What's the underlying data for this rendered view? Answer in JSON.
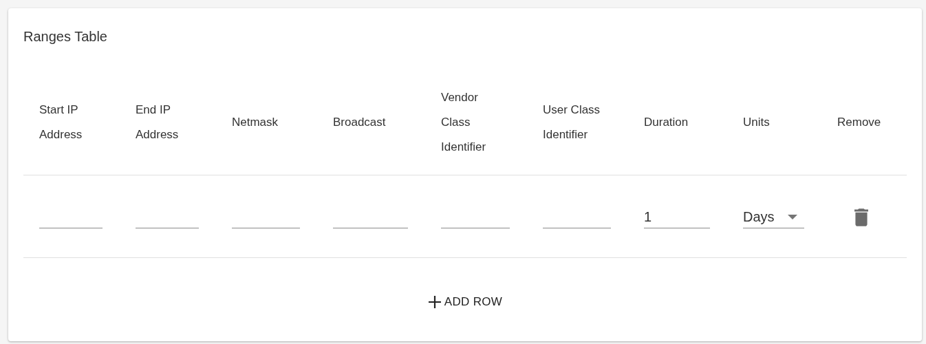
{
  "card": {
    "title": "Ranges Table"
  },
  "table": {
    "columns": [
      "Start IP Address",
      "End IP Address",
      "Netmask",
      "Broadcast",
      "Vendor Class Identifier",
      "User Class Identifier",
      "Duration",
      "Units",
      "Remove"
    ],
    "rows": [
      {
        "cells": [
          {
            "kind": "input"
          },
          {
            "kind": "input"
          },
          {
            "kind": "input"
          },
          {
            "kind": "input"
          },
          {
            "kind": "input"
          },
          {
            "kind": "input"
          },
          {
            "kind": "input",
            "value": "1"
          },
          {
            "kind": "select",
            "value": "Days"
          },
          {
            "kind": "delete"
          }
        ]
      }
    ]
  },
  "add_button": {
    "label": "ADD ROW"
  }
}
